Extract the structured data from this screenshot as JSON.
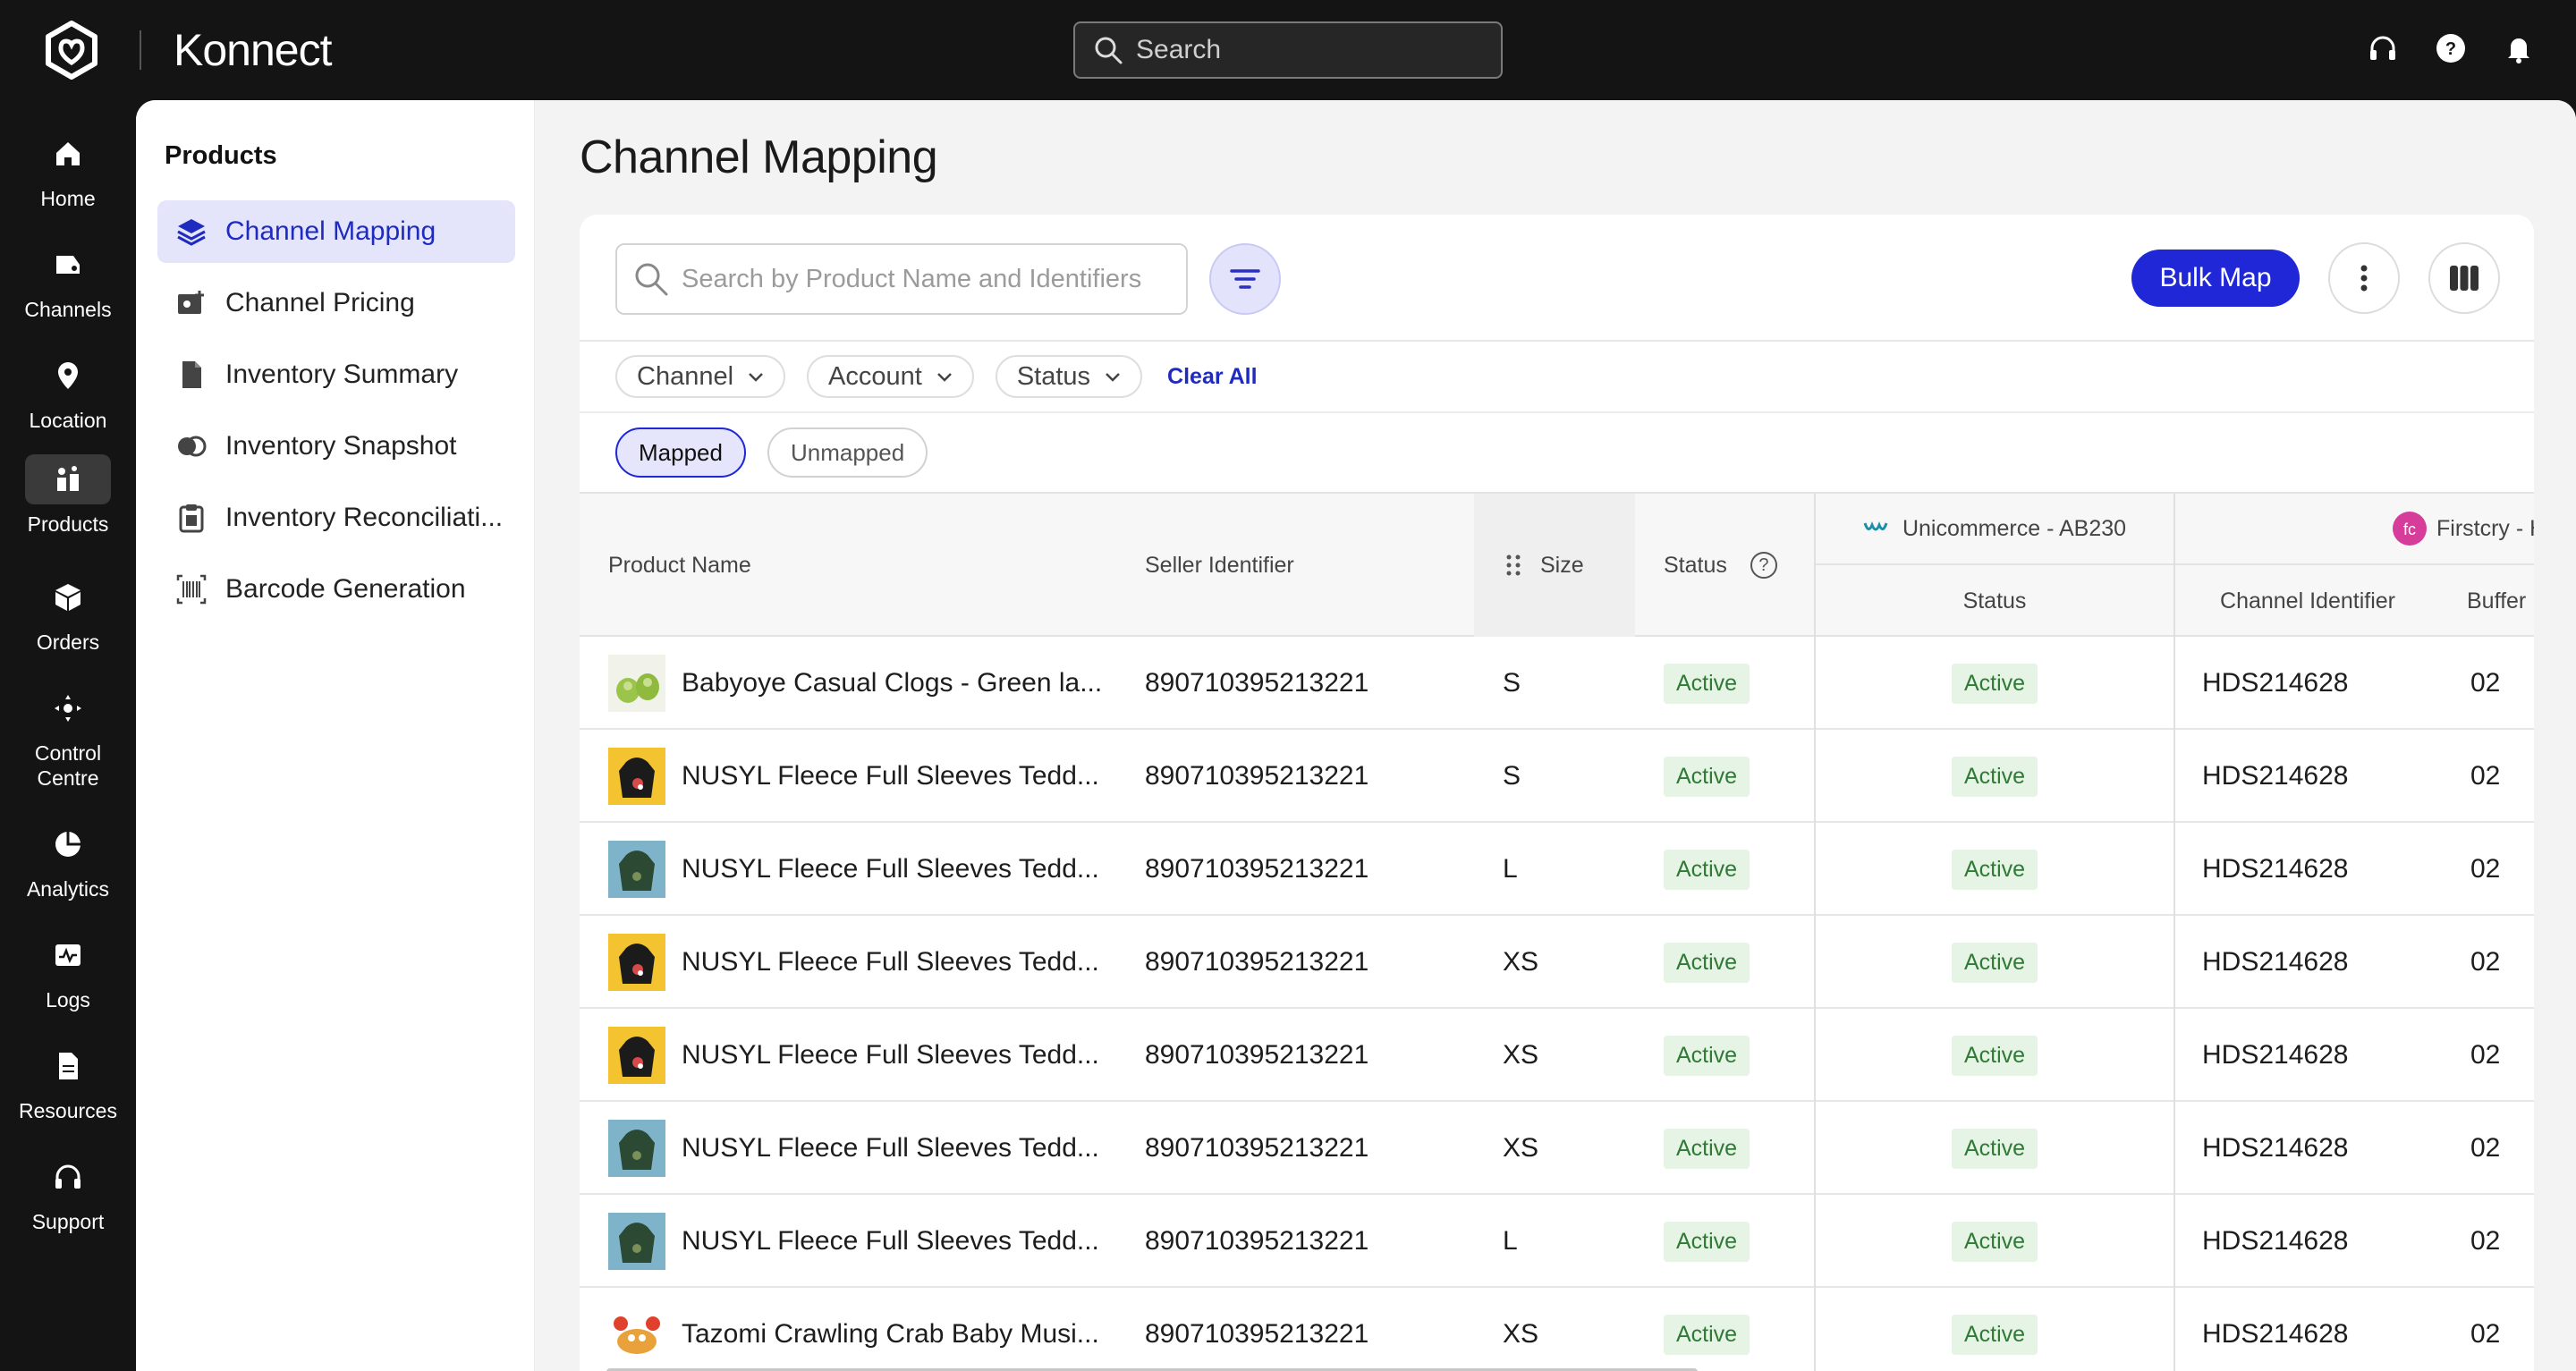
{
  "app": {
    "name": "Konnect",
    "search_placeholder": "Search"
  },
  "rail": [
    {
      "label": "Home",
      "icon": "home-icon"
    },
    {
      "label": "Channels",
      "icon": "channels-icon"
    },
    {
      "label": "Location",
      "icon": "location-pin-icon"
    },
    {
      "label": "Products",
      "icon": "products-icon",
      "active": true
    },
    {
      "label": "Orders",
      "icon": "box-icon"
    },
    {
      "label": "Control Centre",
      "icon": "control-centre-icon"
    },
    {
      "label": "Analytics",
      "icon": "pie-chart-icon"
    },
    {
      "label": "Logs",
      "icon": "logs-icon"
    },
    {
      "label": "Resources",
      "icon": "document-icon"
    },
    {
      "label": "Support",
      "icon": "headset-icon"
    }
  ],
  "subnav": {
    "title": "Products",
    "items": [
      {
        "label": "Channel Mapping",
        "icon": "layers-icon",
        "active": true
      },
      {
        "label": "Channel Pricing",
        "icon": "pricing-icon"
      },
      {
        "label": "Inventory Summary",
        "icon": "file-icon"
      },
      {
        "label": "Inventory Snapshot",
        "icon": "snapshot-icon"
      },
      {
        "label": "Inventory Reconciliati...",
        "icon": "clipboard-icon"
      },
      {
        "label": "Barcode Generation",
        "icon": "barcode-icon"
      }
    ]
  },
  "page": {
    "title": "Channel Mapping"
  },
  "toolbar": {
    "search_placeholder": "Search by Product Name and Identifiers",
    "bulk_map_label": "Bulk Map"
  },
  "filters": {
    "channel": "Channel",
    "account": "Account",
    "status": "Status",
    "clear_all": "Clear All"
  },
  "tabs": {
    "mapped": "Mapped",
    "unmapped": "Unmapped"
  },
  "table": {
    "headers": {
      "product_name": "Product Name",
      "seller_identifier": "Seller Identifier",
      "size": "Size",
      "status": "Status",
      "status_help": "?"
    },
    "channel_groups": [
      {
        "name": "Unicommerce - AB230",
        "sub": [
          "Status"
        ]
      },
      {
        "name": "Firstcry - Ha",
        "sub": [
          "Channel Identifier",
          "Buffer"
        ]
      }
    ],
    "rows": [
      {
        "product": "Babyoye Casual Clogs - Green la...",
        "seller_id": "890710395213221",
        "size": "S",
        "status": "Active",
        "uc_status": "Active",
        "channel_id": "HDS214628",
        "buffer": "02",
        "thumb": "shoe"
      },
      {
        "product": "NUSYL Fleece Full Sleeves Tedd...",
        "seller_id": "890710395213221",
        "size": "S",
        "status": "Active",
        "uc_status": "Active",
        "channel_id": "HDS214628",
        "buffer": "02",
        "thumb": "hoodie-black"
      },
      {
        "product": "NUSYL Fleece Full Sleeves Tedd...",
        "seller_id": "890710395213221",
        "size": "L",
        "status": "Active",
        "uc_status": "Active",
        "channel_id": "HDS214628",
        "buffer": "02",
        "thumb": "hoodie-green"
      },
      {
        "product": "NUSYL Fleece Full Sleeves Tedd...",
        "seller_id": "890710395213221",
        "size": "XS",
        "status": "Active",
        "uc_status": "Active",
        "channel_id": "HDS214628",
        "buffer": "02",
        "thumb": "hoodie-black"
      },
      {
        "product": "NUSYL Fleece Full Sleeves Tedd...",
        "seller_id": "890710395213221",
        "size": "XS",
        "status": "Active",
        "uc_status": "Active",
        "channel_id": "HDS214628",
        "buffer": "02",
        "thumb": "hoodie-black"
      },
      {
        "product": "NUSYL Fleece Full Sleeves Tedd...",
        "seller_id": "890710395213221",
        "size": "XS",
        "status": "Active",
        "uc_status": "Active",
        "channel_id": "HDS214628",
        "buffer": "02",
        "thumb": "hoodie-green"
      },
      {
        "product": "NUSYL Fleece Full Sleeves Tedd...",
        "seller_id": "890710395213221",
        "size": "L",
        "status": "Active",
        "uc_status": "Active",
        "channel_id": "HDS214628",
        "buffer": "02",
        "thumb": "hoodie-green"
      },
      {
        "product": "Tazomi Crawling Crab Baby Musi...",
        "seller_id": "890710395213221",
        "size": "XS",
        "status": "Active",
        "uc_status": "Active",
        "channel_id": "HDS214628",
        "buffer": "02",
        "thumb": "crab"
      }
    ]
  },
  "colors": {
    "accent": "#1f27d6",
    "active_bg": "#e6f4e6",
    "active_text": "#2f7a34",
    "topbar": "#141414"
  }
}
